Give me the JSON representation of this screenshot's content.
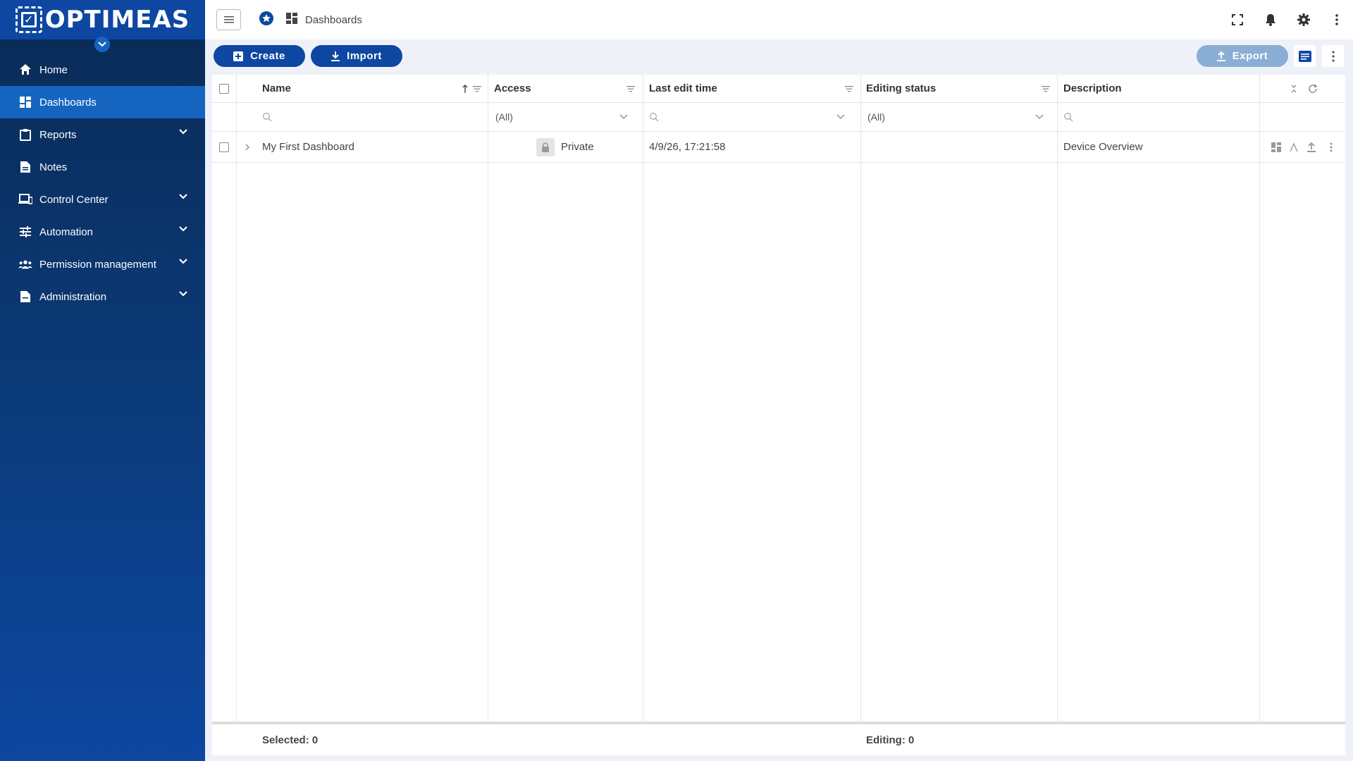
{
  "brand": {
    "name": "OPTIMEAS"
  },
  "sidebar": {
    "items": [
      {
        "label": "Home",
        "icon": "home-icon",
        "active": false,
        "expandable": false
      },
      {
        "label": "Dashboards",
        "icon": "dashboard-icon",
        "active": true,
        "expandable": false
      },
      {
        "label": "Reports",
        "icon": "clipboard-icon",
        "active": false,
        "expandable": true
      },
      {
        "label": "Notes",
        "icon": "note-icon",
        "active": false,
        "expandable": false
      },
      {
        "label": "Control Center",
        "icon": "devices-icon",
        "active": false,
        "expandable": true
      },
      {
        "label": "Automation",
        "icon": "sliders-icon",
        "active": false,
        "expandable": true
      },
      {
        "label": "Permission management",
        "icon": "people-icon",
        "active": false,
        "expandable": true
      },
      {
        "label": "Administration",
        "icon": "document-icon",
        "active": false,
        "expandable": true
      }
    ]
  },
  "topbar": {
    "breadcrumb": "Dashboards"
  },
  "toolbar": {
    "create_label": "Create",
    "import_label": "Import",
    "export_label": "Export"
  },
  "table": {
    "columns": {
      "name": "Name",
      "access": "Access",
      "last_edit_time": "Last edit time",
      "editing_status": "Editing status",
      "description": "Description"
    },
    "filters": {
      "access": "(All)",
      "editing_status": "(All)"
    },
    "rows": [
      {
        "name": "My First Dashboard",
        "access": "Private",
        "last_edit_time": "4/9/26, 17:21:58",
        "editing_status": "",
        "description": "Device Overview"
      }
    ],
    "footer": {
      "selected": "Selected: 0",
      "editing": "Editing: 0"
    }
  },
  "colors": {
    "primary": "#0d47a1",
    "sidebar_dark": "#0a2a55",
    "export_disabled": "#8aaed6"
  }
}
